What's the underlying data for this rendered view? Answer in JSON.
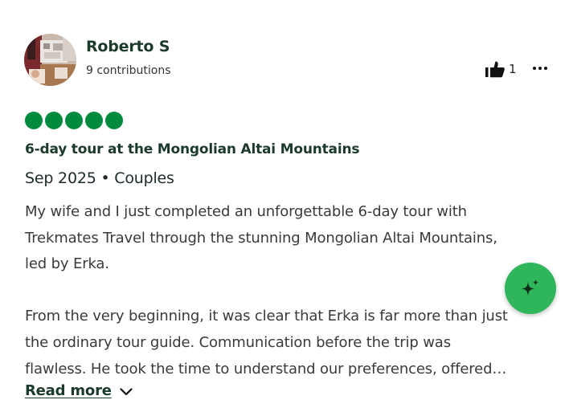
{
  "review": {
    "author": {
      "name": "Roberto S",
      "contributions": "9 contributions"
    },
    "helpful_count": "1",
    "rating": 5,
    "rating_max": 5,
    "title": "6-day tour at the Mongolian Altai Mountains",
    "visit_info": "Sep 2025 • Couples",
    "body_lines": [
      "My wife and I just completed an unforgettable 6-day tour with",
      "Trekmates Travel through the stunning Mongolian Altai Mountains,",
      "led by Erka.",
      "",
      "From the very beginning, it was clear that Erka is far more than just",
      "the ordinary tour guide. Communication before the trip was",
      "flawless. He took the time to understand our preferences, offered…"
    ],
    "read_more_label": "Read more"
  },
  "colors": {
    "rating_bubble": "#008a3e",
    "ai_button": "#2fb65a",
    "heading_text": "#1c3a2a"
  },
  "icons": {
    "helpful": "thumbs-up-icon",
    "more": "more-options-icon",
    "expand": "chevron-down-icon",
    "ai": "sparkle-icon"
  }
}
